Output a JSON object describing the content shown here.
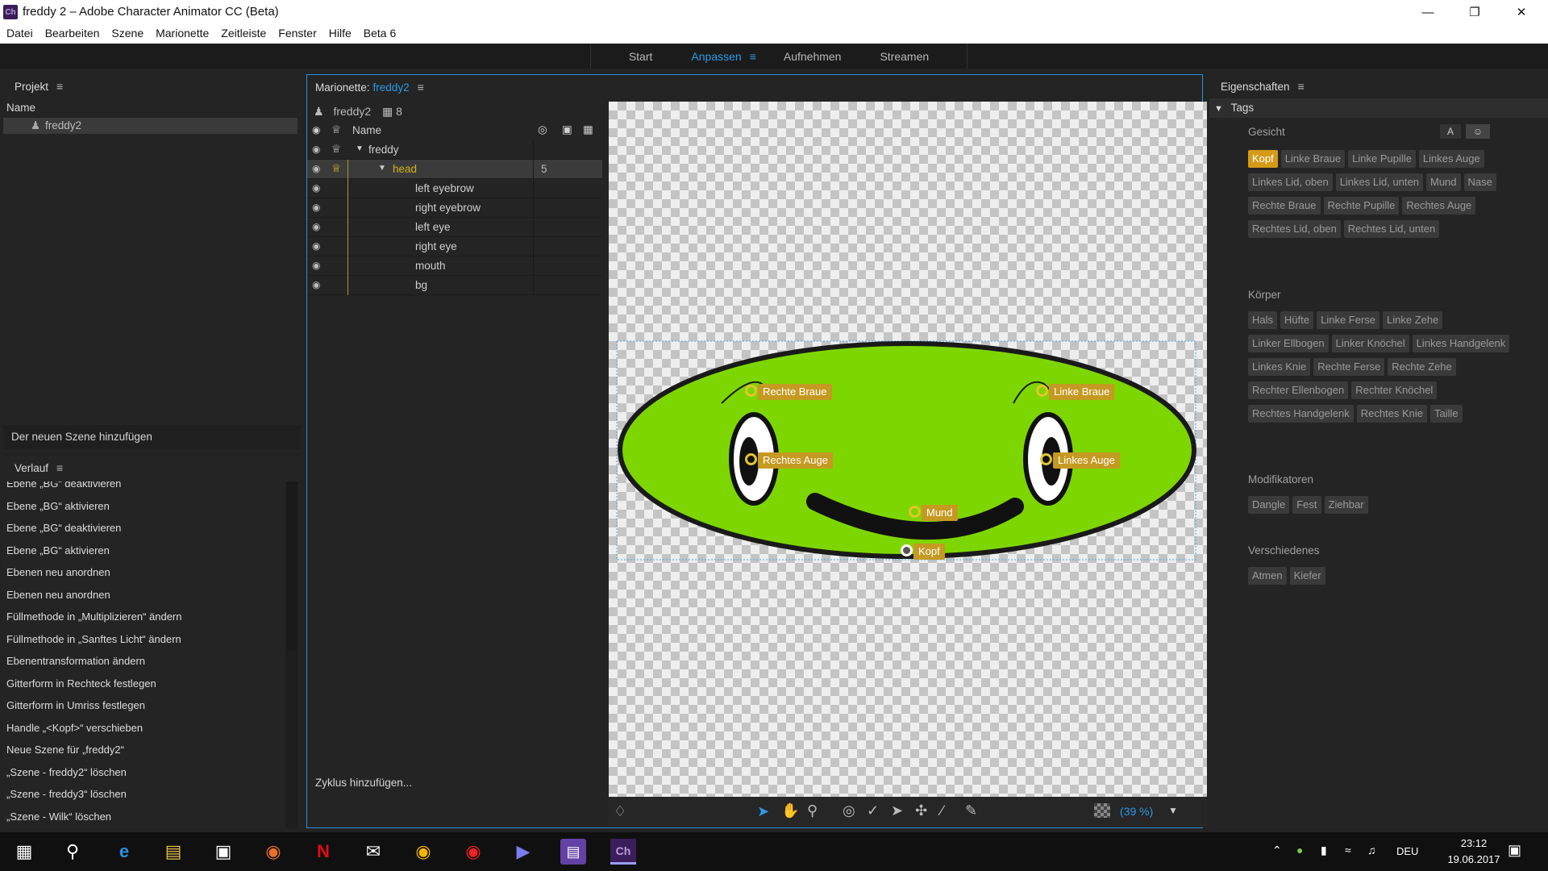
{
  "window": {
    "title": "freddy 2 – Adobe Character Animator CC (Beta)",
    "app_icon": "Ch"
  },
  "menu": [
    "Datei",
    "Bearbeiten",
    "Szene",
    "Marionette",
    "Zeitleiste",
    "Fenster",
    "Hilfe",
    "Beta 6"
  ],
  "workspace_tabs": [
    {
      "label": "Start"
    },
    {
      "label": "Anpassen",
      "active": true
    },
    {
      "label": "Aufnehmen"
    },
    {
      "label": "Streamen"
    }
  ],
  "projekt": {
    "title": "Projekt",
    "col_name": "Name",
    "item": "freddy2",
    "add_button": "Der neuen Szene hinzufügen"
  },
  "verlauf": {
    "title": "Verlauf",
    "items": [
      "Ebene „BG“ deaktivieren",
      "Ebene „BG“ aktivieren",
      "Ebene „BG“ deaktivieren",
      "Ebene „BG“ aktivieren",
      "Ebenen neu anordnen",
      "Ebenen neu anordnen",
      "Füllmethode in „Multiplizieren“ ändern",
      "Füllmethode in „Sanftes Licht“ ändern",
      "Ebenentransformation ändern",
      "Gitterform in Rechteck festlegen",
      "Gitterform in Umriss festlegen",
      "Handle „<Kopf>“ verschieben",
      "Neue Szene für „freddy2“",
      "„Szene - freddy2“ löschen",
      "„Szene - freddy3“ löschen",
      "„Szene - Wilk“ löschen"
    ]
  },
  "marionette": {
    "title_prefix": "Marionette:",
    "puppet_name": "freddy2",
    "puppet_label": "freddy2",
    "count": "8",
    "col_name": "Name",
    "layers": [
      {
        "name": "freddy"
      },
      {
        "name": "head",
        "value": "5"
      },
      {
        "name": "left eyebrow"
      },
      {
        "name": "right eyebrow"
      },
      {
        "name": "left eye"
      },
      {
        "name": "right eye"
      },
      {
        "name": "mouth"
      },
      {
        "name": "bg"
      }
    ],
    "cycle_button": "Zyklus hinzufügen...",
    "zoom": "(39 %)"
  },
  "handles": {
    "right_brow": "Rechte Braue",
    "left_brow": "Linke Braue",
    "right_eye": "Rechtes Auge",
    "left_eye": "Linkes Auge",
    "mouth": "Mund",
    "head": "Kopf"
  },
  "eigenschaften": {
    "title": "Eigenschaften",
    "tags_title": "Tags",
    "letter_btn": "A",
    "sections": {
      "gesicht": {
        "title": "Gesicht",
        "tags": [
          "Kopf",
          "Linke Braue",
          "Linke Pupille",
          "Linkes Auge",
          "Linkes Lid, oben",
          "Linkes Lid, unten",
          "Mund",
          "Nase",
          "Rechte Braue",
          "Rechte Pupille",
          "Rechtes Auge",
          "Rechtes Lid, oben",
          "Rechtes Lid, unten"
        ]
      },
      "koerper": {
        "title": "Körper",
        "tags": [
          "Hals",
          "Hüfte",
          "Linke Ferse",
          "Linke Zehe",
          "Linker Ellbogen",
          "Linker Knöchel",
          "Linkes Handgelenk",
          "Linkes Knie",
          "Rechte Ferse",
          "Rechte Zehe",
          "Rechter Ellenbogen",
          "Rechter Knöchel",
          "Rechtes Handgelenk",
          "Rechtes Knie",
          "Taille"
        ]
      },
      "modifikatoren": {
        "title": "Modifikatoren",
        "tags": [
          "Dangle",
          "Fest",
          "Ziehbar"
        ]
      },
      "verschiedenes": {
        "title": "Verschiedenes",
        "tags": [
          "Atmen",
          "Kiefer"
        ]
      }
    },
    "active_tag": "Kopf"
  },
  "taskbar": {
    "lang": "DEU",
    "time": "23:12",
    "date": "19.06.2017"
  },
  "colors": {
    "accent": "#2d9ae8",
    "tag_active": "#d49b18",
    "face_green": "#7ed600",
    "handle": "#c49a22"
  }
}
